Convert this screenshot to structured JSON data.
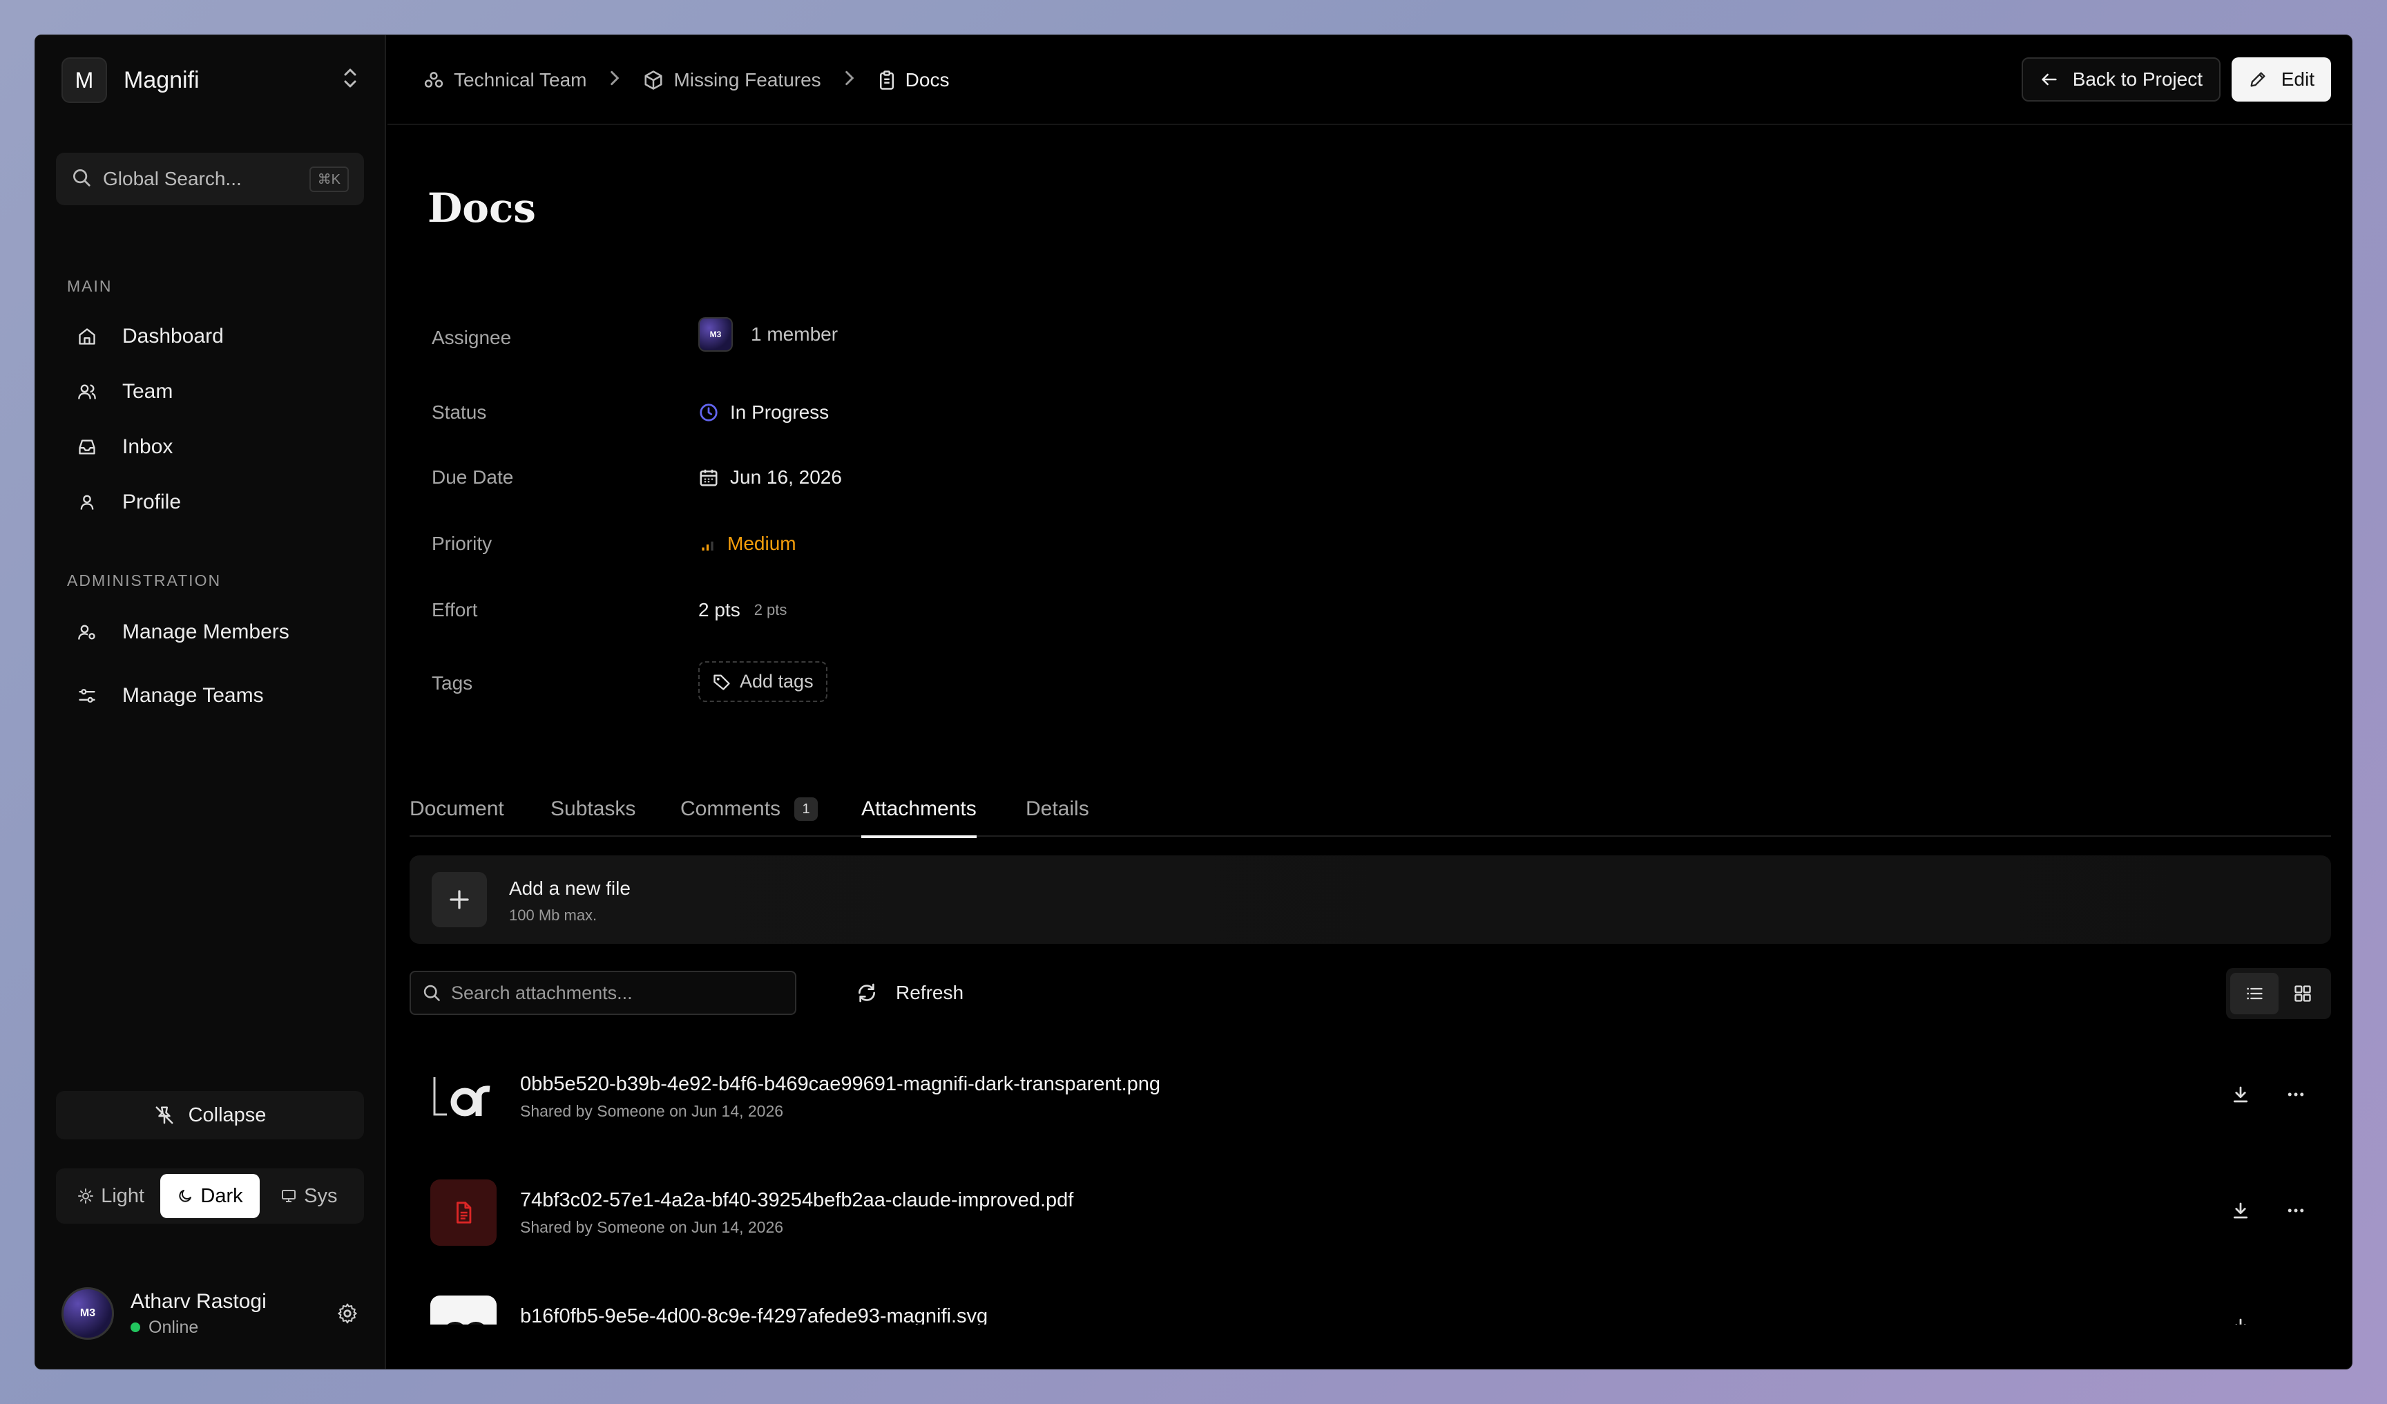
{
  "org": {
    "initial": "M",
    "name": "Magnifi"
  },
  "search": {
    "placeholder": "Global Search...",
    "shortcut": "⌘K"
  },
  "sidebar": {
    "main_label": "MAIN",
    "main_items": [
      {
        "label": "Dashboard",
        "icon": "home-icon"
      },
      {
        "label": "Team",
        "icon": "users-icon"
      },
      {
        "label": "Inbox",
        "icon": "inbox-icon"
      },
      {
        "label": "Profile",
        "icon": "user-icon"
      }
    ],
    "admin_label": "ADMINISTRATION",
    "admin_items": [
      {
        "label": "Manage Members",
        "icon": "user-cog-icon"
      },
      {
        "label": "Manage Teams",
        "icon": "sliders-icon"
      }
    ],
    "collapse_label": "Collapse",
    "theme": {
      "light": "Light",
      "dark": "Dark",
      "sys": "Sys",
      "selected": "Dark"
    },
    "user": {
      "avatar_text": "M3",
      "name": "Atharv Rastogi",
      "status": "Online"
    }
  },
  "breadcrumb": [
    {
      "label": "Technical Team",
      "icon": "team-icon"
    },
    {
      "label": "Missing Features",
      "icon": "box-icon"
    },
    {
      "label": "Docs",
      "icon": "clipboard-icon"
    }
  ],
  "header": {
    "back_label": "Back to Project",
    "edit_label": "Edit"
  },
  "task": {
    "title": "Docs",
    "properties": {
      "assignee_label": "Assignee",
      "assignee_avatar": "M3",
      "assignee_value": "1 member",
      "status_label": "Status",
      "status_value": "In Progress",
      "due_label": "Due Date",
      "due_value": "Jun 16, 2026",
      "priority_label": "Priority",
      "priority_value": "Medium",
      "effort_label": "Effort",
      "effort_value": "2 pts",
      "effort_hint": "2 pts",
      "tags_label": "Tags",
      "tags_button": "Add tags"
    }
  },
  "tabs": [
    {
      "label": "Document"
    },
    {
      "label": "Subtasks"
    },
    {
      "label": "Comments",
      "badge": "1"
    },
    {
      "label": "Attachments",
      "active": true
    },
    {
      "label": "Details"
    }
  ],
  "upload": {
    "title": "Add a new file",
    "subtitle": "100 Mb max."
  },
  "attachments": {
    "search_placeholder": "Search attachments...",
    "refresh_label": "Refresh",
    "view": "list",
    "files": [
      {
        "name": "0bb5e520-b39b-4e92-b4f6-b469cae99691-magnifi-dark-transparent.png",
        "meta": "Shared by Someone on Jun 14, 2026",
        "thumb": "logo-dark-thumbnail"
      },
      {
        "name": "74bf3c02-57e1-4a2a-bf40-39254befb2aa-claude-improved.pdf",
        "meta": "Shared by Someone on Jun 14, 2026",
        "thumb": "pdf-file-icon"
      },
      {
        "name": "b16f0fb5-9e5e-4d00-8c9e-f4297afede93-magnifi.svg",
        "meta": "",
        "thumb": "logo-light-thumbnail"
      }
    ]
  },
  "colors": {
    "status_in_progress": "#6366f1",
    "priority_medium": "#f59e0b",
    "online": "#22c55e",
    "pdf_icon": "#dc2626"
  }
}
